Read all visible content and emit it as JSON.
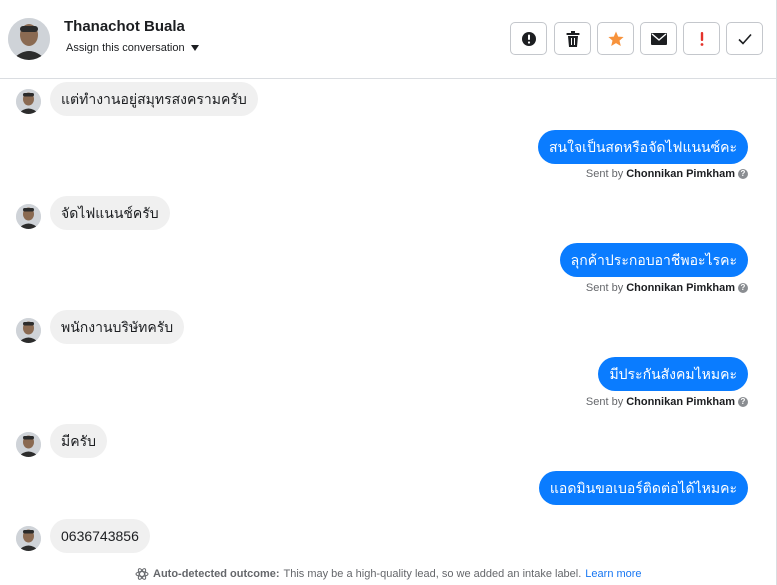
{
  "header": {
    "contact_name": "Thanachot Buala",
    "assign_label": "Assign this conversation",
    "actions": [
      {
        "name": "spam-report-button",
        "icon": "alert-circle-icon"
      },
      {
        "name": "delete-button",
        "icon": "trash-icon"
      },
      {
        "name": "star-button",
        "icon": "star-icon"
      },
      {
        "name": "mark-unread-button",
        "icon": "envelope-icon"
      },
      {
        "name": "follow-up-button",
        "icon": "exclamation-icon"
      },
      {
        "name": "mark-done-button",
        "icon": "checkmark-icon"
      }
    ],
    "star_color": "#f7923b",
    "flag_color": "#e4322b"
  },
  "colors": {
    "outgoing_bubble": "#0a7cff",
    "incoming_bubble": "#f0f0f0"
  },
  "messages": [
    {
      "direction": "in",
      "text": "แต่ทำงานอยู่สมุทรสงครามครับ"
    },
    {
      "direction": "out",
      "text": "สนใจเป็นสดหรือจัดไฟแนนซ์คะ",
      "sent_by_prefix": "Sent by",
      "sender": "Chonnikan Pimkham"
    },
    {
      "direction": "in",
      "text": "จัดไฟแนนช์ครับ"
    },
    {
      "direction": "out",
      "text": "ลุกค้าประกอบอาชีพอะไรคะ",
      "sent_by_prefix": "Sent by",
      "sender": "Chonnikan Pimkham"
    },
    {
      "direction": "in",
      "text": "พนักงานบริษัทครับ"
    },
    {
      "direction": "out",
      "text": "มีประกันสังคมไหมคะ",
      "sent_by_prefix": "Sent by",
      "sender": "Chonnikan Pimkham"
    },
    {
      "direction": "in",
      "text": "มีครับ"
    },
    {
      "direction": "out",
      "text": "แอดมินขอเบอร์ติดต่อได้ไหมคะ"
    },
    {
      "direction": "in",
      "text": "0636743856"
    }
  ],
  "footer": {
    "label": "Auto-detected outcome:",
    "text": "This may be a high-quality lead, so we added an intake label.",
    "link": "Learn more"
  }
}
